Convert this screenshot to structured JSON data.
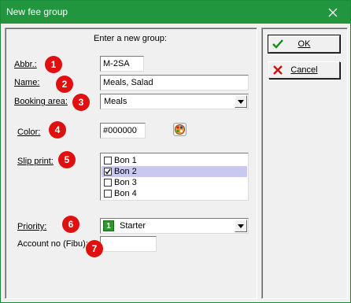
{
  "window": {
    "title": "New fee group"
  },
  "form": {
    "heading": "Enter a new group:",
    "abbr_label": "Abbr.:",
    "abbr_value": "M-2SA",
    "name_label": "Name:",
    "name_value": "Meals, Salad",
    "booking_area_label": "Booking area:",
    "booking_area_value": "Meals",
    "color_label": "Color:",
    "color_value": "#000000",
    "slip_print_label": "Slip print:",
    "slip_items": [
      {
        "label": "Bon 1",
        "checked": false
      },
      {
        "label": "Bon 2",
        "checked": true
      },
      {
        "label": "Bon 3",
        "checked": false
      },
      {
        "label": "Bon 4",
        "checked": false
      }
    ],
    "priority_label": "Priority:",
    "priority_value": "Starter",
    "priority_badge": "1",
    "account_label": "Account no (Fibu):",
    "account_value": ""
  },
  "badges": [
    "1",
    "2",
    "3",
    "4",
    "5",
    "6",
    "7"
  ],
  "buttons": {
    "ok": "OK",
    "cancel": "Cancel"
  },
  "colors": {
    "titlebar": "#22953f",
    "badge": "#e01010",
    "selection": "#c8c8f0"
  }
}
